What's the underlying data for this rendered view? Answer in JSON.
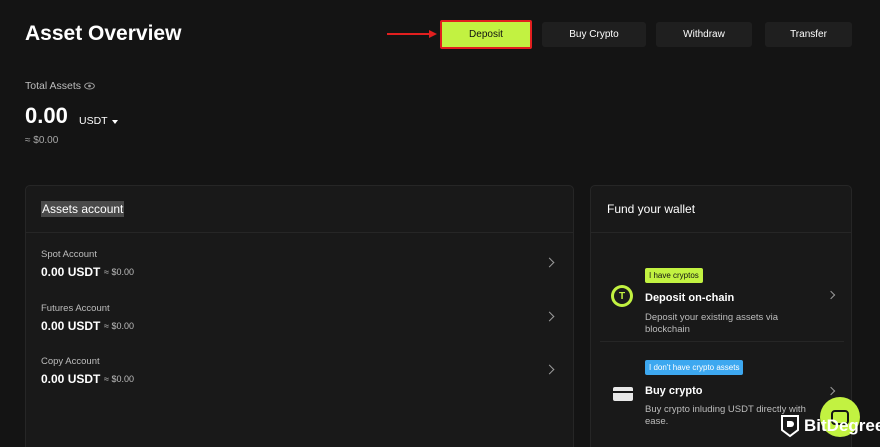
{
  "header": {
    "title": "Asset Overview",
    "buttons": {
      "deposit": "Deposit",
      "buy_crypto": "Buy Crypto",
      "withdraw": "Withdraw",
      "transfer": "Transfer"
    }
  },
  "summary": {
    "label": "Total Assets",
    "amount": "0.00",
    "currency": "USDT",
    "fiat": "≈ $0.00"
  },
  "assets_account": {
    "title": "Assets account",
    "rows": [
      {
        "label": "Spot Account",
        "amount": "0.00 USDT",
        "fiat": "≈ $0.00"
      },
      {
        "label": "Futures Account",
        "amount": "0.00 USDT",
        "fiat": "≈ $0.00"
      },
      {
        "label": "Copy Account",
        "amount": "0.00 USDT",
        "fiat": "≈ $0.00"
      }
    ]
  },
  "fund_wallet": {
    "title": "Fund your wallet",
    "cards": [
      {
        "tag": "I have cryptos",
        "title": "Deposit on-chain",
        "desc": "Deposit your existing assets via blockchain",
        "icon": "tether-icon"
      },
      {
        "tag": "I don't have crypto assets",
        "title": "Buy crypto",
        "desc": "Buy crypto inluding USDT directly with ease.",
        "icon": "card-icon"
      }
    ]
  },
  "watermark": {
    "text": "BitDegree"
  },
  "colors": {
    "background": "#141414",
    "panel": "#191919",
    "accent": "#c2f241",
    "highlight_border": "#e21f1f",
    "tag_blue": "#3da8f0"
  }
}
